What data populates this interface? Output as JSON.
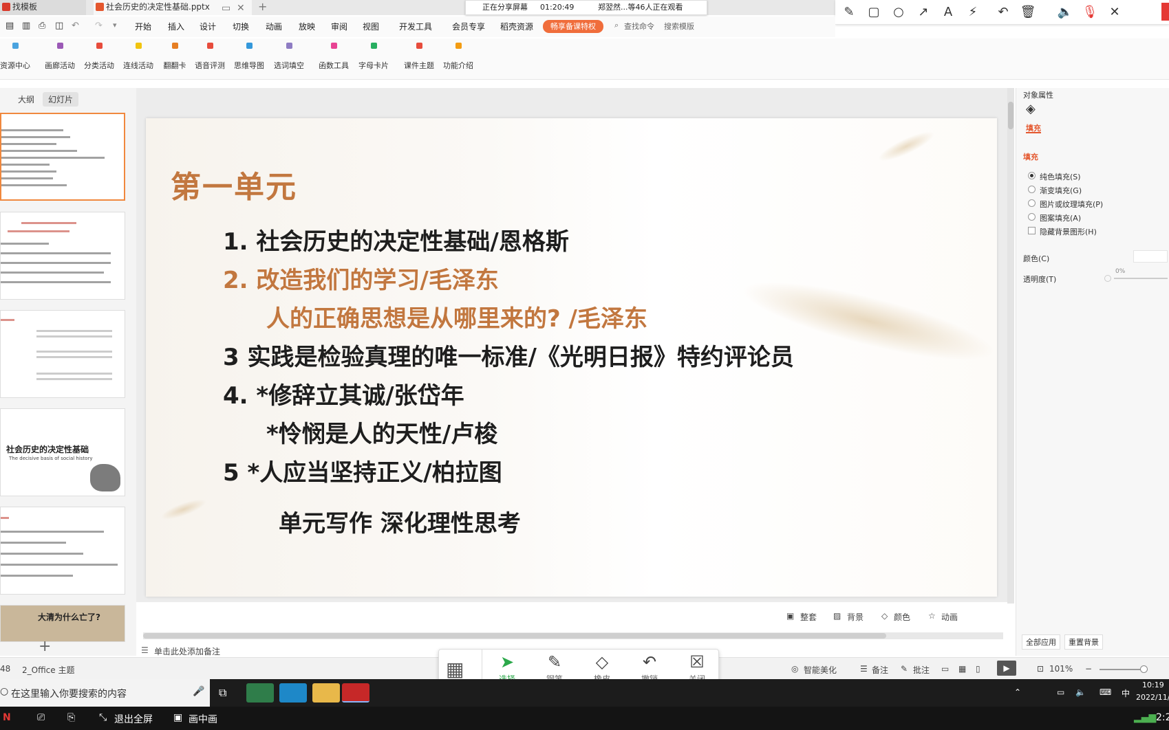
{
  "tabs": [
    {
      "label": "找模板"
    },
    {
      "label": "社会历史的决定性基础.pptx"
    }
  ],
  "share_overlay": {
    "status": "正在分享屏幕",
    "time": "01:20:49",
    "viewers": "郑翌然...等46人正在观看"
  },
  "annotation_tools": [
    "pencil-icon",
    "rectangle-icon",
    "circle-icon",
    "arrow-icon",
    "text-icon",
    "magic-wand-icon",
    "undo-icon",
    "trash-icon",
    "speaker-icon",
    "mic-muted-icon",
    "close-icon"
  ],
  "menu": [
    "开始",
    "插入",
    "设计",
    "切换",
    "动画",
    "放映",
    "审阅",
    "视图",
    "开发工具",
    "会员专享",
    "稻壳资源"
  ],
  "member_badge": "畅享备课特权",
  "search_cmd": "查找命令",
  "search_template": "搜索模版",
  "ribbon_tools": [
    {
      "label": "资源中心",
      "color": "#4aa3df"
    },
    {
      "label": "画廊活动",
      "color": "#9b59b6"
    },
    {
      "label": "分类活动",
      "color": "#e74c3c"
    },
    {
      "label": "连线活动",
      "color": "#f1c40f"
    },
    {
      "label": "翻翻卡",
      "color": "#e67e22"
    },
    {
      "label": "语音评测",
      "color": "#e74c3c"
    },
    {
      "label": "思维导图",
      "color": "#3498db"
    },
    {
      "label": "选词填空",
      "color": "#8e7cc3"
    },
    {
      "label": "函数工具",
      "color": "#e84393"
    },
    {
      "label": "字母卡片",
      "color": "#27ae60"
    },
    {
      "label": "课件主题",
      "color": "#e74c3c"
    },
    {
      "label": "功能介绍",
      "color": "#f39c12"
    }
  ],
  "left_pane": {
    "tab_outline": "大纲",
    "tab_slides": "幻灯片",
    "thumb4_title": "社会历史的决定性基础",
    "thumb4_sub": "The decisive basis of social history",
    "thumb6_title": "大清为什么亡了?"
  },
  "slide": {
    "title": "第一单元",
    "lines": [
      "1.   社会历史的决定性基础/恩格斯",
      "2.   改造我们的学习/毛泽东",
      "人的正确思想是从哪里来的? /毛泽东",
      "3    实践是检验真理的唯一标准/《光明日报》特约评论员",
      "4.   *修辞立其诚/张岱年",
      "*怜悯是人的天性/卢梭",
      "5    *人应当坚持正义/柏拉图",
      "单元写作    深化理性思考"
    ]
  },
  "slide_tools": [
    "整套",
    "背景",
    "颜色",
    "动画"
  ],
  "notes_placeholder": "单击此处添加备注",
  "right_pane": {
    "header": "对象属性",
    "tab_fill": "填充",
    "section_fill": "填充",
    "options": [
      "纯色填充(S)",
      "渐变填充(G)",
      "图片或纹理填充(P)",
      "图案填充(A)"
    ],
    "hide_bg": "隐藏背景图形(H)",
    "color_label": "颜色(C)",
    "transparency_label": "透明度(T)",
    "transparency_value": "0%",
    "apply_all": "全部应用",
    "reset_bg": "重置背景"
  },
  "status_bar": {
    "slide_count": "48",
    "theme": "2_Office 主题",
    "smart": "智能美化",
    "notes": "备注",
    "comment": "批注",
    "zoom": "101%"
  },
  "pen_toolbar": [
    {
      "label": "选择",
      "icon": "cursor-icon"
    },
    {
      "label": "钢笔",
      "icon": "pen-icon"
    },
    {
      "label": "橡皮",
      "icon": "eraser-icon"
    },
    {
      "label": "撤销",
      "icon": "undo-icon"
    },
    {
      "label": "关闭",
      "icon": "close-icon"
    }
  ],
  "taskbar": {
    "search_placeholder": "在这里输入你要搜索的内容",
    "ime": "中",
    "time": "10:19",
    "date": "2022/11/"
  },
  "bottom_bar": {
    "exit_full": "退出全屏",
    "pip": "画中画",
    "clock": "2:2"
  }
}
